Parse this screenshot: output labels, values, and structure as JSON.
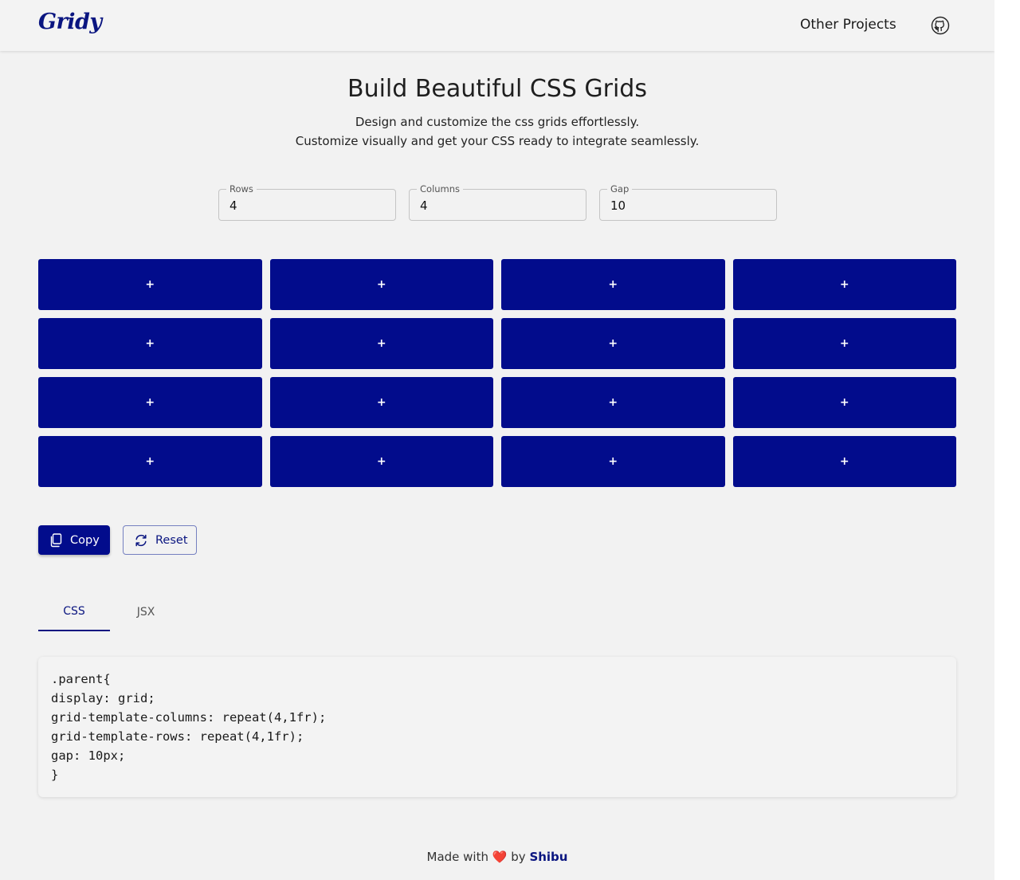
{
  "header": {
    "logo": "Gridy",
    "nav_link": "Other Projects",
    "github_icon": "github-icon"
  },
  "hero": {
    "title": "Build Beautiful CSS Grids",
    "subtitle_line1": "Design and customize the css grids effortlessly.",
    "subtitle_line2": "Customize visually and get your CSS ready to integrate seamlessly."
  },
  "controls": {
    "rows": {
      "label": "Rows",
      "value": "4"
    },
    "columns": {
      "label": "Columns",
      "value": "4"
    },
    "gap": {
      "label": "Gap",
      "value": "10"
    }
  },
  "grid": {
    "cell_label": "+",
    "cell_color": "#020c8c",
    "rows": 4,
    "columns": 4
  },
  "actions": {
    "copy_label": "Copy",
    "reset_label": "Reset"
  },
  "tabs": [
    {
      "label": "CSS",
      "active": true
    },
    {
      "label": "JSX",
      "active": false
    }
  ],
  "code": {
    "lines": [
      ".parent{",
      "display: grid;",
      "grid-template-columns: repeat(4,1fr);",
      "grid-template-rows: repeat(4,1fr);",
      "gap: 10px;",
      "}"
    ]
  },
  "footer": {
    "prefix": "Made with",
    "heart": "❤️",
    "by": "by",
    "author": "Shibu"
  },
  "colors": {
    "accent": "#0a1580",
    "background": "#f2f2f2"
  }
}
